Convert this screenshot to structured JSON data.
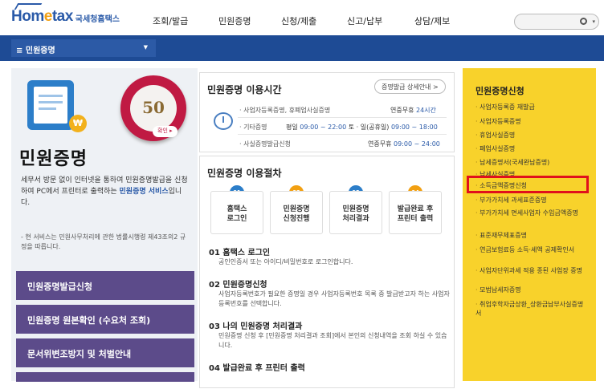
{
  "header": {
    "logo_main_a": "Hom",
    "logo_main_e": "e",
    "logo_main_b": "tax",
    "logo_sub": "국세청홈택스",
    "nav": [
      "조회/발급",
      "민원증명",
      "신청/제출",
      "신고/납부",
      "상담/제보"
    ]
  },
  "subnav": {
    "selected": "민원증명"
  },
  "left": {
    "badge_num": "50",
    "badge_btn": "확인",
    "title": "민원증명",
    "desc_a": "세무서 방문 없이 인터넷을 통하여 민원증명발급을 신청하여 PC에서 프린터로 출력하는 ",
    "desc_hl": "민원증명 서비스",
    "desc_b": "입니다.",
    "note": "- 현 서비스는 민원사무처리에 관한 법률시행령 제43조의2 규정을 따릅니다.",
    "buttons": [
      "민원증명발급신청",
      "민원증명 원본확인 (수요처 조회)",
      "문서위변조방지 및 처벌안내"
    ]
  },
  "hours": {
    "title": "민원증명 이용시간",
    "detail_btn": "증명발급 상세안내 >",
    "rows": [
      {
        "label": "· 사업자등록증명, 휴폐업사실증명",
        "right_a": "연중무휴 ",
        "right_b": "24시간"
      },
      {
        "label": "· 기타증명",
        "right_a": "평일 ",
        "right_b": "09:00 ~ 22:00",
        "right_c": "  토 · 일(공휴일) ",
        "right_d": "09:00 ~ 18:00"
      },
      {
        "label": "· 사실증명발급신청",
        "right_a": "연중무휴 ",
        "right_b": "09:00 ~ 24:00"
      }
    ]
  },
  "process": {
    "title": "민원증명 이용절차",
    "steps": [
      {
        "num": "01",
        "label": "홈택스\n로그인"
      },
      {
        "num": "02",
        "label": "민원증명\n신청진행"
      },
      {
        "num": "03",
        "label": "민원증명\n처리결과"
      },
      {
        "num": "04",
        "label": "발급완료 후\n프린터 출력"
      }
    ],
    "details": [
      {
        "head": "01 홈택스 로그인",
        "text": "공인인증서 또는 아이디/비밀번호로 로그인합니다."
      },
      {
        "head": "02 민원증명신청",
        "text": "사업자등록번호가 필요한 증명일 경우 사업자등록번호 목록 중 발급받고자 하는 사업자등록번호를 선택합니다."
      },
      {
        "head": "03 나의 민원증명 처리결과",
        "text": "민원증명 신청 후 [민원증명 처리결과 조회]에서 본인의 신청내역을 조회 하실 수 있습니다."
      },
      {
        "head": "04 발급완료 후 프린터 출력",
        "text": ""
      }
    ]
  },
  "right": {
    "title": "민원증명신청",
    "items": [
      "사업자등록증 재발급",
      "사업자등록증명",
      "휴업사실증명",
      "폐업사실증명",
      "납세증명서(국세완납증명)",
      "납세사실증명",
      "소득금액증명신청",
      "부가가치세 과세표준증명",
      "부가가치세 면세사업자 수입금액증명",
      "표준재무제표증명",
      "연금보험료등 소득·세액 공제확인서",
      "사업자단위과세 적용 종된 사업장 증명",
      "모범납세자증명",
      "취업후학자금상환_상환금납부사실증명서"
    ],
    "highlighted_index": 6,
    "highlight_color": "#e0101c"
  },
  "colors": {
    "navy": "#1e4b95",
    "purple": "#5c4b8a",
    "yellow": "#f8d22b",
    "step_blue": "#2c7ec9",
    "step_orange": "#f2a012"
  }
}
